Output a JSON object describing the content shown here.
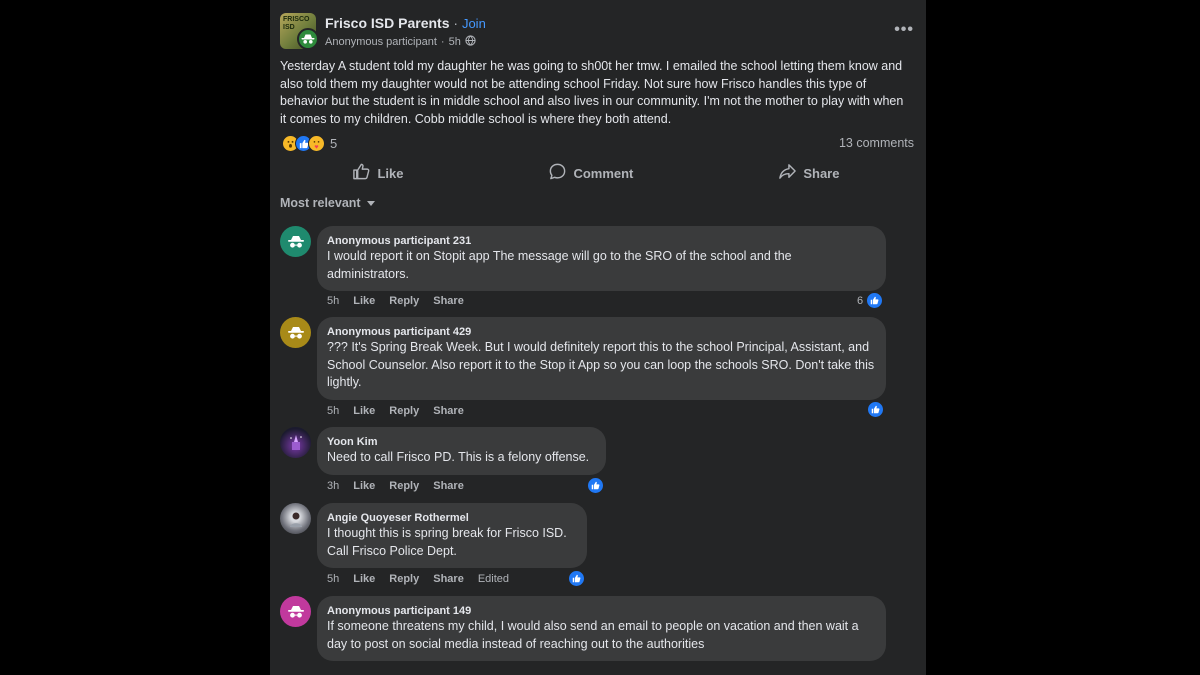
{
  "post": {
    "group_name": "Frisco ISD Parents",
    "separator": "·",
    "join_label": "Join",
    "group_avatar_text": "FRISCO ISD",
    "author": "Anonymous participant",
    "time": "5h",
    "body": "Yesterday A student told my daughter he was going to sh00t her tmw. I emailed the school letting them know and also told them my daughter would not be attending school Friday. Not sure how Frisco handles this type of behavior but the student is in middle school and also lives in our community. I'm not the mother to play with when it comes to my children. Cobb middle school is where they both attend.",
    "reaction_count": "5",
    "comment_count": "13 comments",
    "actions": {
      "like": "Like",
      "comment": "Comment",
      "share": "Share"
    },
    "sort_label": "Most relevant"
  },
  "comment_actions": {
    "like": "Like",
    "reply": "Reply",
    "share": "Share"
  },
  "comments": [
    {
      "name": "Anonymous participant 231",
      "text": "I would report it on Stopit app The message will go to the SRO of the school and the administrators.",
      "time": "5h",
      "likes": "6",
      "avatar_color": "#1f8a6e"
    },
    {
      "name": "Anonymous participant 429",
      "text": "??? It's Spring Break Week. But I would definitely report this to the school Principal, Assistant, and School Counselor. Also report it to the Stop it App so you can loop the schools SRO. Don't take this lightly.",
      "time": "5h",
      "likes": "",
      "avatar_color": "#a88a18"
    },
    {
      "name": "Yoon Kim",
      "text": "Need to call Frisco PD. This is a felony offense.",
      "time": "3h",
      "likes": "",
      "avatar_color": "#1b1a2e"
    },
    {
      "name": "Angie Quoyeser Rothermel",
      "text": "I thought this is spring break for Frisco ISD. Call Frisco Police Dept.",
      "time": "5h",
      "likes": "",
      "edited": "Edited",
      "avatar_color": "#6d6f78"
    },
    {
      "name": "Anonymous participant 149",
      "text": "If someone threatens my child, I would also send an email to people on vacation and then wait a day to post on social media instead of reaching out to the authorities",
      "time": "",
      "likes": "",
      "avatar_color": "#c1399d"
    }
  ]
}
